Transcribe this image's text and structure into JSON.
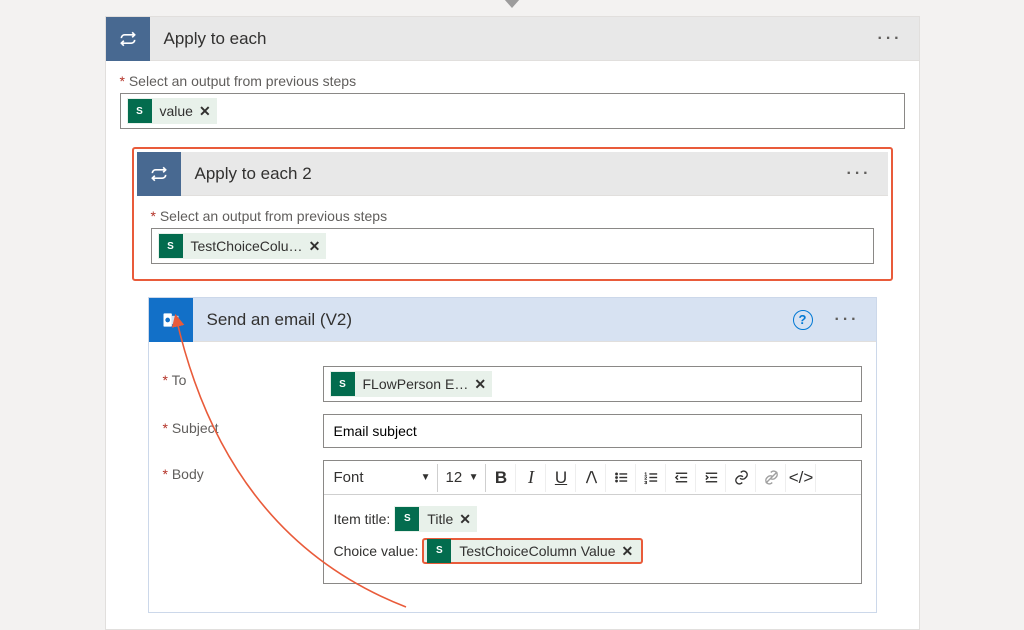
{
  "root": {
    "title": "Apply to each",
    "outputs_label": "Select an output from previous steps",
    "token": "value"
  },
  "inner": {
    "title": "Apply to each 2",
    "outputs_label": "Select an output from previous steps",
    "token": "TestChoiceColu…"
  },
  "email": {
    "title": "Send an email (V2)",
    "to_label": "To",
    "to_token": "FLowPerson E…",
    "subject_label": "Subject",
    "subject_value": "Email subject",
    "body_label": "Body",
    "toolbar": {
      "font": "Font",
      "size": "12"
    },
    "body": {
      "line1_label": "Item title:",
      "line1_token": "Title",
      "line2_label": "Choice value:",
      "line2_token": "TestChoiceColumn Value"
    }
  },
  "icons": {
    "sp_badge": "S"
  }
}
